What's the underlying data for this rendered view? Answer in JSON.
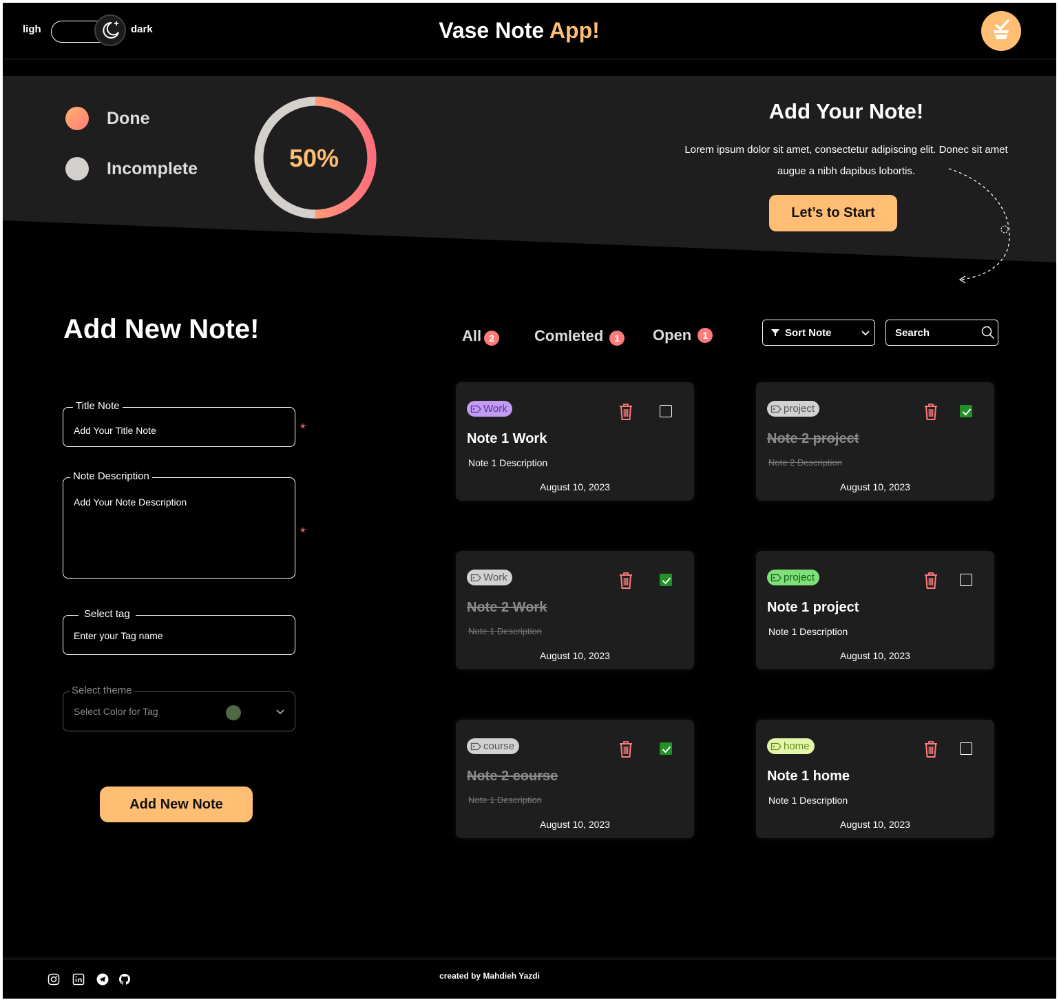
{
  "header": {
    "toggle_light_label": "ligh",
    "toggle_dark_label": "dark",
    "title_main": "Vase Note",
    "title_accent": "App!"
  },
  "hero": {
    "legend": [
      {
        "label": "Done",
        "color": "#ff9a76"
      },
      {
        "label": "Incomplete",
        "color": "#d4d0cb"
      }
    ],
    "progress_text": "50%",
    "progress_fraction": 0.5,
    "title": "Add Your Note!",
    "text": "Lorem ipsum dolor sit amet, consectetur adipiscing elit. Donec sit amet augue a nibh dapibus lobortis.",
    "cta_label": "Let’s to Start"
  },
  "form": {
    "title": "Add New Note!",
    "title_field": {
      "legend": "Title Note",
      "placeholder": "Add Your Title Note"
    },
    "description_field": {
      "legend": "Note Description",
      "placeholder": "Add Your Note Description"
    },
    "tag_field": {
      "legend": "Select tag",
      "placeholder": "Enter your Tag name"
    },
    "theme_field": {
      "legend": "Select theme",
      "placeholder": "Select Color for Tag",
      "selected_color": "#4d6a45"
    },
    "required_mark": "*",
    "submit_label": "Add New Note"
  },
  "filters": {
    "tabs": [
      {
        "label": "All",
        "count": "2"
      },
      {
        "label": "Comleted",
        "count": "1"
      },
      {
        "label": "Open",
        "count": "1"
      }
    ],
    "sort_label": "Sort Note",
    "search_placeholder": "Search"
  },
  "notes": [
    {
      "tag": "Work",
      "title": "Note 1 Work",
      "description": "Note 1 Description",
      "date": "August 10, 2023",
      "done": false
    },
    {
      "tag": "project",
      "title": "Note 2 project",
      "description": "Note 2 Description",
      "date": "August 10, 2023",
      "done": true
    },
    {
      "tag": "Work",
      "title": "Note 2 Work",
      "description": "Note 1 Description",
      "date": "August 10, 2023",
      "done": true
    },
    {
      "tag": "project",
      "title": "Note 1 project",
      "description": "Note 1 Description",
      "date": "August 10, 2023",
      "done": false
    },
    {
      "tag": "course",
      "title": "Note 2 course",
      "description": "Note 1 Description",
      "date": "August 10, 2023",
      "done": true
    },
    {
      "tag": "home",
      "title": "Note 1 home",
      "description": "Note 1 Description",
      "date": "August 10, 2023",
      "done": false
    }
  ],
  "footer": {
    "icons": [
      "instagram-icon",
      "linkedin-icon",
      "telegram-icon",
      "github-icon"
    ],
    "credit": "created by Mahdieh Yazdi"
  },
  "colors": {
    "accent": "#ffbe74",
    "danger": "#ff7a7a",
    "check": "#239025",
    "card_bg": "#1f1e1f",
    "hero_bg": "#1f1e1f"
  }
}
